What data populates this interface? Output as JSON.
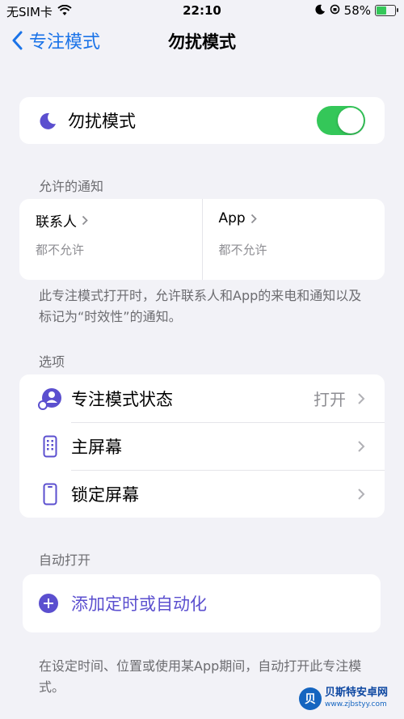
{
  "status_bar": {
    "carrier": "无SIM卡",
    "time": "22:10",
    "battery_percent": "58%",
    "battery_level": 0.58,
    "battery_color": "#34c759"
  },
  "nav": {
    "back_label": "专注模式",
    "title": "勿扰模式"
  },
  "focus_toggle": {
    "label": "勿扰模式",
    "icon": "moon-icon",
    "enabled": true,
    "accent": "#34c759"
  },
  "allowed_notifications": {
    "header": "允许的通知",
    "people": {
      "title": "联系人",
      "subtitle": "都不允许"
    },
    "apps": {
      "title": "App",
      "subtitle": "都不允许"
    },
    "footnote": "此专注模式打开时，允许联系人和App的来电和通知以及标记为“时效性”的通知。"
  },
  "options": {
    "header": "选项",
    "items": [
      {
        "label": "专注模式状态",
        "value": "打开",
        "icon": "focus-status-icon"
      },
      {
        "label": "主屏幕",
        "value": "",
        "icon": "home-screen-icon"
      },
      {
        "label": "锁定屏幕",
        "value": "",
        "icon": "lock-screen-icon"
      }
    ]
  },
  "auto_on": {
    "header": "自动打开",
    "add_label": "添加定时或自动化",
    "accent": "#5b4fcf",
    "footnote": "在设定时间、位置或使用某App期间，自动打开此专注模式。"
  },
  "watermark": {
    "name": "贝斯特安卓网",
    "url": "www.zjbstyy.com"
  }
}
